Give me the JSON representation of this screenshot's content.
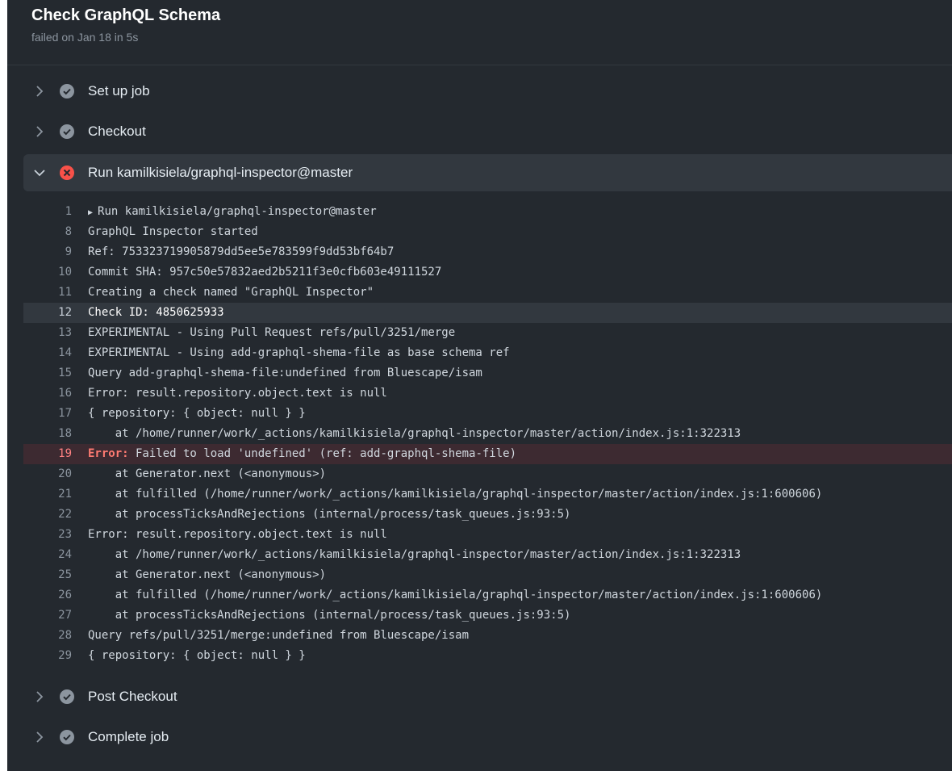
{
  "job": {
    "title": "Check GraphQL Schema",
    "subtitle": "failed on Jan 18 in 5s"
  },
  "colors": {
    "panel_bg": "#24292f",
    "success_icon": "#8c959f",
    "failure_icon": "#f85149",
    "error_text": "#ff7b72"
  },
  "steps_before": [
    {
      "label": "Set up job",
      "status": "success",
      "expanded": false,
      "icon": "check-circle-icon"
    },
    {
      "label": "Checkout",
      "status": "success",
      "expanded": false,
      "icon": "check-circle-icon"
    }
  ],
  "active_step": {
    "label": "Run kamilkisiela/graphql-inspector@master",
    "status": "failure",
    "expanded": true,
    "icon": "x-circle-icon"
  },
  "log_lines": [
    {
      "n": "1",
      "prefix": "",
      "text": "Run kamilkisiela/graphql-inspector@master",
      "kind": "group"
    },
    {
      "n": "8",
      "prefix": "",
      "text": "GraphQL Inspector started",
      "kind": ""
    },
    {
      "n": "9",
      "prefix": "",
      "text": "Ref: 753323719905879dd5ee5e783599f9dd53bf64b7",
      "kind": ""
    },
    {
      "n": "10",
      "prefix": "",
      "text": "Commit SHA: 957c50e57832aed2b5211f3e0cfb603e49111527",
      "kind": ""
    },
    {
      "n": "11",
      "prefix": "",
      "text": "Creating a check named \"GraphQL Inspector\"",
      "kind": ""
    },
    {
      "n": "12",
      "prefix": "",
      "text": "Check ID: 4850625933",
      "kind": "highlight"
    },
    {
      "n": "13",
      "prefix": "",
      "text": "EXPERIMENTAL - Using Pull Request refs/pull/3251/merge",
      "kind": ""
    },
    {
      "n": "14",
      "prefix": "",
      "text": "EXPERIMENTAL - Using add-graphql-shema-file as base schema ref",
      "kind": ""
    },
    {
      "n": "15",
      "prefix": "",
      "text": "Query add-graphql-shema-file:undefined from Bluescape/isam",
      "kind": ""
    },
    {
      "n": "16",
      "prefix": "",
      "text": "Error: result.repository.object.text is null",
      "kind": ""
    },
    {
      "n": "17",
      "prefix": "",
      "text": "{ repository: { object: null } }",
      "kind": ""
    },
    {
      "n": "18",
      "prefix": "",
      "text": "    at /home/runner/work/_actions/kamilkisiela/graphql-inspector/master/action/index.js:1:322313",
      "kind": ""
    },
    {
      "n": "19",
      "prefix": "Error:",
      "text": " Failed to load 'undefined' (ref: add-graphql-shema-file)",
      "kind": "error"
    },
    {
      "n": "20",
      "prefix": "",
      "text": "    at Generator.next (<anonymous>)",
      "kind": ""
    },
    {
      "n": "21",
      "prefix": "",
      "text": "    at fulfilled (/home/runner/work/_actions/kamilkisiela/graphql-inspector/master/action/index.js:1:600606)",
      "kind": ""
    },
    {
      "n": "22",
      "prefix": "",
      "text": "    at processTicksAndRejections (internal/process/task_queues.js:93:5)",
      "kind": ""
    },
    {
      "n": "23",
      "prefix": "",
      "text": "Error: result.repository.object.text is null",
      "kind": ""
    },
    {
      "n": "24",
      "prefix": "",
      "text": "    at /home/runner/work/_actions/kamilkisiela/graphql-inspector/master/action/index.js:1:322313",
      "kind": ""
    },
    {
      "n": "25",
      "prefix": "",
      "text": "    at Generator.next (<anonymous>)",
      "kind": ""
    },
    {
      "n": "26",
      "prefix": "",
      "text": "    at fulfilled (/home/runner/work/_actions/kamilkisiela/graphql-inspector/master/action/index.js:1:600606)",
      "kind": ""
    },
    {
      "n": "27",
      "prefix": "",
      "text": "    at processTicksAndRejections (internal/process/task_queues.js:93:5)",
      "kind": ""
    },
    {
      "n": "28",
      "prefix": "",
      "text": "Query refs/pull/3251/merge:undefined from Bluescape/isam",
      "kind": ""
    },
    {
      "n": "29",
      "prefix": "",
      "text": "{ repository: { object: null } }",
      "kind": ""
    }
  ],
  "steps_after": [
    {
      "label": "Post Checkout",
      "status": "success",
      "expanded": false,
      "icon": "check-circle-icon"
    },
    {
      "label": "Complete job",
      "status": "success",
      "expanded": false,
      "icon": "check-circle-icon"
    }
  ]
}
